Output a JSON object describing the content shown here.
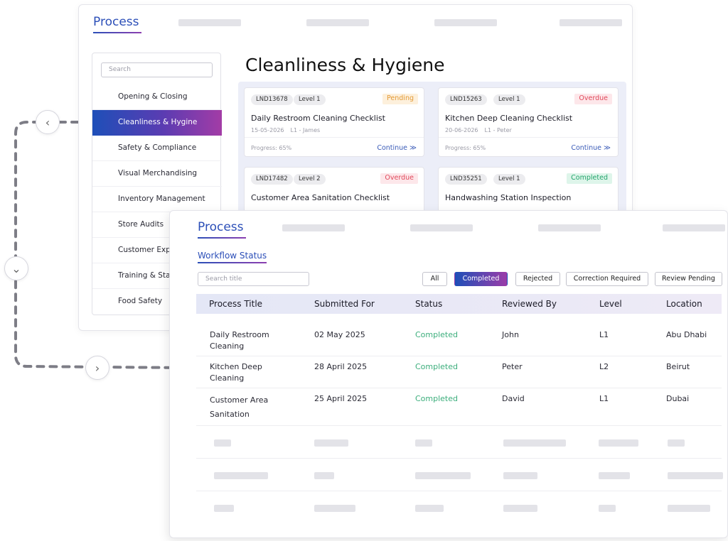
{
  "back_panel": {
    "title": "Process",
    "search_placeholder": "Search",
    "sidebar_items": [
      {
        "label": "Opening & Closing"
      },
      {
        "label": "Cleanliness & Hygine",
        "active": true
      },
      {
        "label": "Safety & Compliance"
      },
      {
        "label": "Visual Merchandising"
      },
      {
        "label": "Inventory Management"
      },
      {
        "label": "Store Audits"
      },
      {
        "label": "Customer Expe"
      },
      {
        "label": "Training & Staff"
      },
      {
        "label": "Food Safety"
      }
    ],
    "heading": "Cleanliness & Hygiene",
    "cards": [
      {
        "code": "LND13678",
        "level": "Level 1",
        "status": "Pending",
        "title": "Daily Restroom Cleaning Checklist",
        "date": "15-05-2026",
        "assignee": "L1 - James",
        "progress": "Progress: 65%",
        "action": "Continue ≫"
      },
      {
        "code": "LND15263",
        "level": "Level 1",
        "status": "Overdue",
        "title": "Kitchen Deep Cleaning Checklist",
        "date": "20-06-2026",
        "assignee": "L1 - Peter",
        "progress": "Progress: 65%",
        "action": "Continue ≫"
      },
      {
        "code": "LND17482",
        "level": "Level 2",
        "status": "Overdue",
        "title": "Customer Area Sanitation Checklist"
      },
      {
        "code": "LND35251",
        "level": "Level 1",
        "status": "Completed",
        "title": "Handwashing Station Inspection"
      }
    ]
  },
  "front_panel": {
    "title": "Process",
    "section": "Workflow Status",
    "search_placeholder": "Search title",
    "filters": [
      {
        "label": "All"
      },
      {
        "label": "Completed",
        "active": true
      },
      {
        "label": "Rejected"
      },
      {
        "label": "Correction Required"
      },
      {
        "label": "Review Pending"
      }
    ],
    "columns": [
      "Process Title",
      "Submitted For",
      "Status",
      "Reviewed By",
      "Level",
      "Location"
    ],
    "rows": [
      {
        "title_l1": "Daily Restroom",
        "title_l2": "Cleaning",
        "submitted": "02 May 2025",
        "status": "Completed",
        "reviewer": "John",
        "level": "L1",
        "location": "Abu Dhabi"
      },
      {
        "title_l1": "Kitchen Deep",
        "title_l2": "Cleaning",
        "submitted": "28 April 2025",
        "status": "Completed",
        "reviewer": "Peter",
        "level": "L2",
        "location": "Beirut"
      },
      {
        "title_l1": "Customer Area",
        "title_l2": "Sanitation",
        "submitted": "25 April 2025",
        "status": "Completed",
        "reviewer": "David",
        "level": "L1",
        "location": "Dubai"
      }
    ]
  },
  "nav_icons": [
    "chevron-left-icon",
    "chevron-down-icon",
    "chevron-right-icon"
  ],
  "colors": {
    "accent_blue": "#2c4fb8",
    "accent_purple": "#a33ca6",
    "completed": "#3cae7c",
    "overdue": "#e0485a",
    "pending": "#e39a36"
  }
}
